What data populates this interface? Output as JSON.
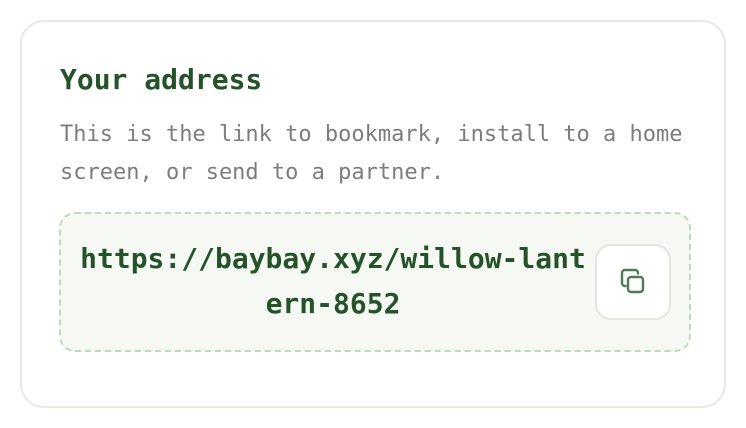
{
  "card": {
    "title": "Your address",
    "description": "This is the link to bookmark, install to a home screen, or send to a partner.",
    "address": "https://baybay.xyz/willow-lantern-8652",
    "copy_button_icon": "copy-icon",
    "accent_color": "#24532a"
  }
}
